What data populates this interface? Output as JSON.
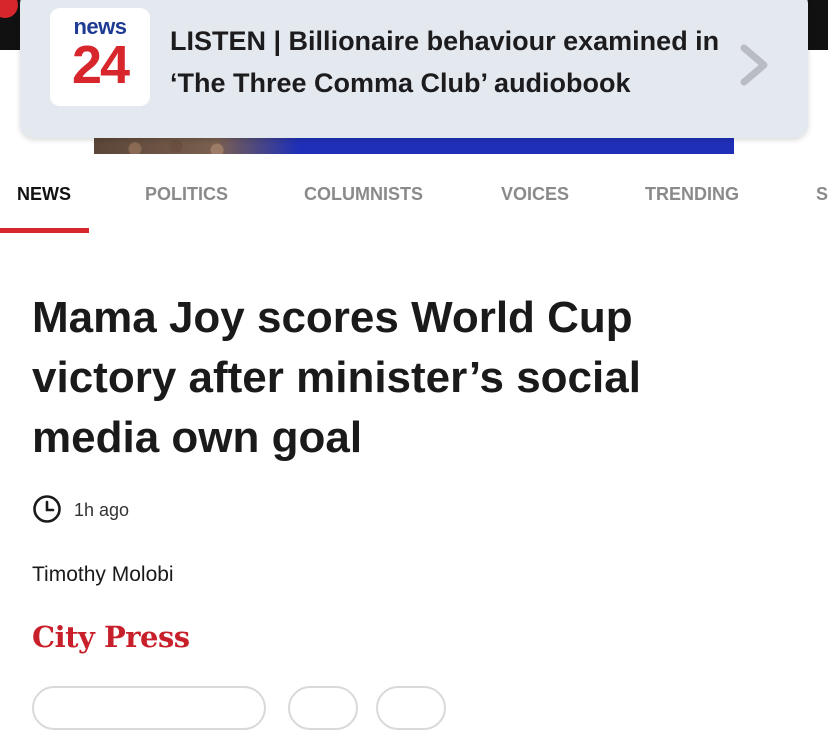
{
  "notification": {
    "app_brand_top": "news",
    "app_brand_bottom": "24",
    "text": "LISTEN | Billionaire behaviour examined in ‘The Three Comma Club’ audiobook",
    "icons": [
      "chevron-right-icon"
    ]
  },
  "nav": {
    "items": [
      {
        "label": "NEWS",
        "active": true
      },
      {
        "label": "POLITICS",
        "active": false
      },
      {
        "label": "COLUMNISTS",
        "active": false
      },
      {
        "label": "VOICES",
        "active": false
      },
      {
        "label": "TRENDING",
        "active": false
      },
      {
        "label": "S",
        "active": false
      }
    ]
  },
  "article": {
    "headline": "Mama Joy scores World Cup victory after minister’s social media own goal",
    "time": "1h ago",
    "author": "Timothy Molobi",
    "source": "City Press"
  },
  "colors": {
    "accent": "#d7262c",
    "brand_blue": "#1f3a93",
    "notification_bg": "#e4e8ef",
    "source_red": "#c8202a"
  }
}
